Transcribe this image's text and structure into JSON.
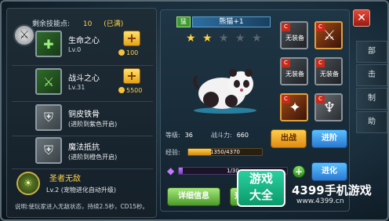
{
  "remaining_points": {
    "label": "剩余技能点:",
    "value": "10",
    "full": "(已满)"
  },
  "skills": [
    {
      "name": "生命之心",
      "level": "Lv.0",
      "cost": "100",
      "icon": "heart-plus-icon",
      "upgradable": true
    },
    {
      "name": "战斗之心",
      "level": "Lv.31",
      "cost": "5500",
      "icon": "sword-plus-icon",
      "upgradable": true
    },
    {
      "name": "铜皮铁骨",
      "note": "(进阶到紫色开启)",
      "icon": "shield-icon",
      "upgradable": false
    },
    {
      "name": "魔法抵抗",
      "note": "(进阶到橙色开启)",
      "icon": "magic-shield-icon",
      "upgradable": false
    }
  ],
  "special": {
    "name": "圣者无敌",
    "level": "Lv.2",
    "note": "(宠物进化自动升级)",
    "desc": "说明:使玩家进入无敌状态，持续2.5秒，CD15秒。"
  },
  "pet": {
    "tag": "猛",
    "name": "熊猫+1",
    "stars_on": 2,
    "stars_total": 5,
    "level_label": "等级:",
    "level": "36",
    "power_label": "战斗力:",
    "power": "660",
    "exp_label": "经验:",
    "exp": "1350/4370",
    "exp_fraction": 0.309,
    "evo": "1/30",
    "evo_fraction": 0.033
  },
  "equipment": [
    {
      "label": "无装备",
      "equipped": false
    },
    {
      "label": "",
      "equipped": true
    },
    {
      "label": "无装备",
      "equipped": false
    },
    {
      "label": "无装备",
      "equipped": false
    },
    {
      "label": "",
      "equipped": true
    },
    {
      "label": "",
      "equipped": true
    }
  ],
  "buttons": {
    "battle": "出战",
    "advance": "进阶",
    "evolve": "进化",
    "details": "详细信息",
    "more": "升"
  },
  "side_tabs": [
    "部",
    "击",
    "制",
    "助"
  ],
  "close": "✕",
  "watermark": {
    "logo": "游戏\n大全",
    "brand": "4399手机游戏",
    "url": "www.4399.cn"
  },
  "colors": {
    "gold": "#ffd24a",
    "blue_btn": "#2a78d0",
    "orange_btn": "#e08a12"
  }
}
